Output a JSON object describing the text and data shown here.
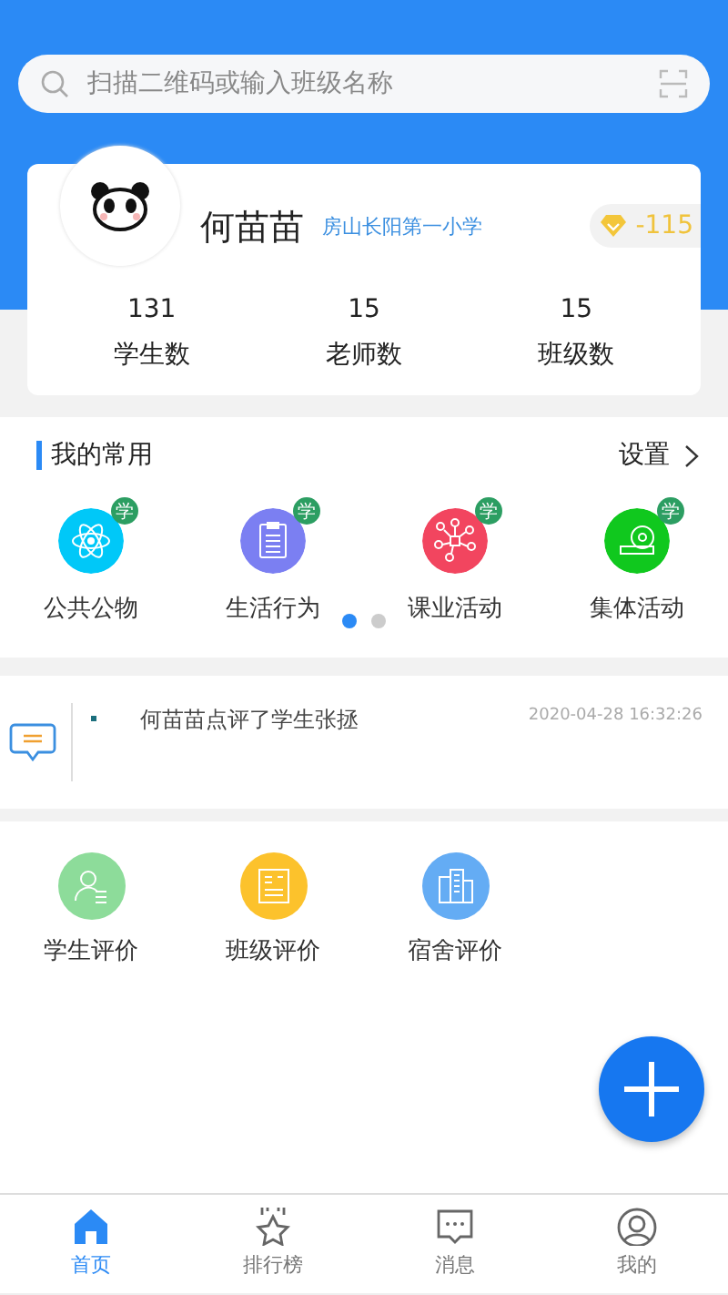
{
  "search": {
    "placeholder": "扫描二维码或输入班级名称"
  },
  "profile": {
    "name": "何苗苗",
    "school": "房山长阳第一小学",
    "points": "-115",
    "stats": [
      {
        "value": "131",
        "label": "学生数"
      },
      {
        "value": "15",
        "label": "老师数"
      },
      {
        "value": "15",
        "label": "班级数"
      }
    ]
  },
  "favorites": {
    "title": "我的常用",
    "action": "设置",
    "items": [
      {
        "label": "公共公物",
        "badge": "学",
        "color": "#00c8f8"
      },
      {
        "label": "生活行为",
        "badge": "学",
        "color": "#7b7ff2"
      },
      {
        "label": "课业活动",
        "badge": "学",
        "color": "#f2455f"
      },
      {
        "label": "集体活动",
        "badge": "学",
        "color": "#10c81e"
      }
    ],
    "pages": [
      {
        "selected": true
      },
      {
        "selected": false
      }
    ]
  },
  "feed": [
    {
      "text": "何苗苗点评了学生张拯",
      "time": "2020-04-28 16:32:26"
    }
  ],
  "evaluations": [
    {
      "label": "学生评价",
      "color": "#8ddc9a"
    },
    {
      "label": "班级评价",
      "color": "#fcc22c"
    },
    {
      "label": "宿舍评价",
      "color": "#64acf4"
    }
  ],
  "tabs": [
    {
      "label": "首页",
      "selected": true
    },
    {
      "label": "排行榜",
      "selected": false
    },
    {
      "label": "消息",
      "selected": false
    },
    {
      "label": "我的",
      "selected": false
    }
  ]
}
